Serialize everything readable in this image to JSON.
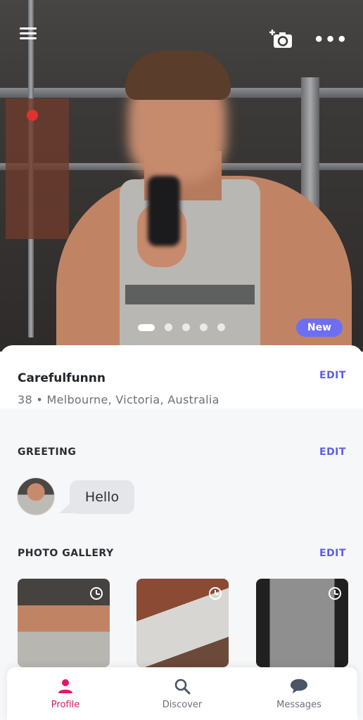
{
  "hero": {
    "badge": "New",
    "photo_count": 5,
    "active_photo_index": 0
  },
  "profile": {
    "username": "Carefulfunnn",
    "location": "38 • Melbourne, Victoria, Australia",
    "edit_label": "EDIT"
  },
  "greeting": {
    "title": "GREETING",
    "edit_label": "EDIT",
    "message": "Hello"
  },
  "gallery": {
    "title": "PHOTO GALLERY",
    "edit_label": "EDIT",
    "items": [
      {
        "status_icon": "clock-icon"
      },
      {
        "status_icon": "clock-icon"
      },
      {
        "status_icon": "clock-icon"
      }
    ]
  },
  "nav": {
    "items": [
      {
        "label": "Profile",
        "icon": "person-icon",
        "active": true
      },
      {
        "label": "Discover",
        "icon": "search-icon",
        "active": false
      },
      {
        "label": "Messages",
        "icon": "chat-bubble-icon",
        "active": false
      }
    ]
  },
  "colors": {
    "accent": "#5e5ce6",
    "badge": "#6e6ef2",
    "active_nav": "#e0176d"
  }
}
